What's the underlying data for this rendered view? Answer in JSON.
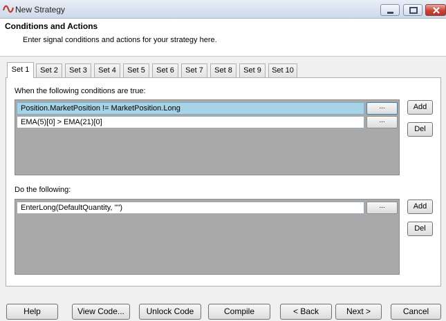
{
  "window": {
    "title": "New Strategy",
    "icon": "ninja-wave-icon"
  },
  "header": {
    "title": "Conditions and Actions",
    "subtitle": "Enter signal conditions and actions for your strategy here."
  },
  "tabs": [
    {
      "label": "Set 1",
      "active": true
    },
    {
      "label": "Set 2",
      "active": false
    },
    {
      "label": "Set 3",
      "active": false
    },
    {
      "label": "Set 4",
      "active": false
    },
    {
      "label": "Set 5",
      "active": false
    },
    {
      "label": "Set 6",
      "active": false
    },
    {
      "label": "Set 7",
      "active": false
    },
    {
      "label": "Set 8",
      "active": false
    },
    {
      "label": "Set 9",
      "active": false
    },
    {
      "label": "Set 10",
      "active": false
    }
  ],
  "conditions": {
    "label": "When the following conditions are true:",
    "items": [
      {
        "text": "Position.MarketPosition != MarketPosition.Long",
        "selected": true
      },
      {
        "text": "EMA(5)[0] > EMA(21)[0]",
        "selected": false
      }
    ],
    "add_label": "Add",
    "del_label": "Del"
  },
  "actions": {
    "label": "Do the following:",
    "items": [
      {
        "text": "EnterLong(DefaultQuantity, \"\")",
        "selected": false
      }
    ],
    "add_label": "Add",
    "del_label": "Del"
  },
  "ellipsis": "...",
  "footer": {
    "help": "Help",
    "view_code": "View Code...",
    "unlock_code": "Unlock Code",
    "compile": "Compile",
    "back": "< Back",
    "next": "Next >",
    "cancel": "Cancel"
  },
  "colors": {
    "selected_row": "#a7d3e7",
    "list_background": "#a9a9a9",
    "close_button": "#c8453a"
  }
}
